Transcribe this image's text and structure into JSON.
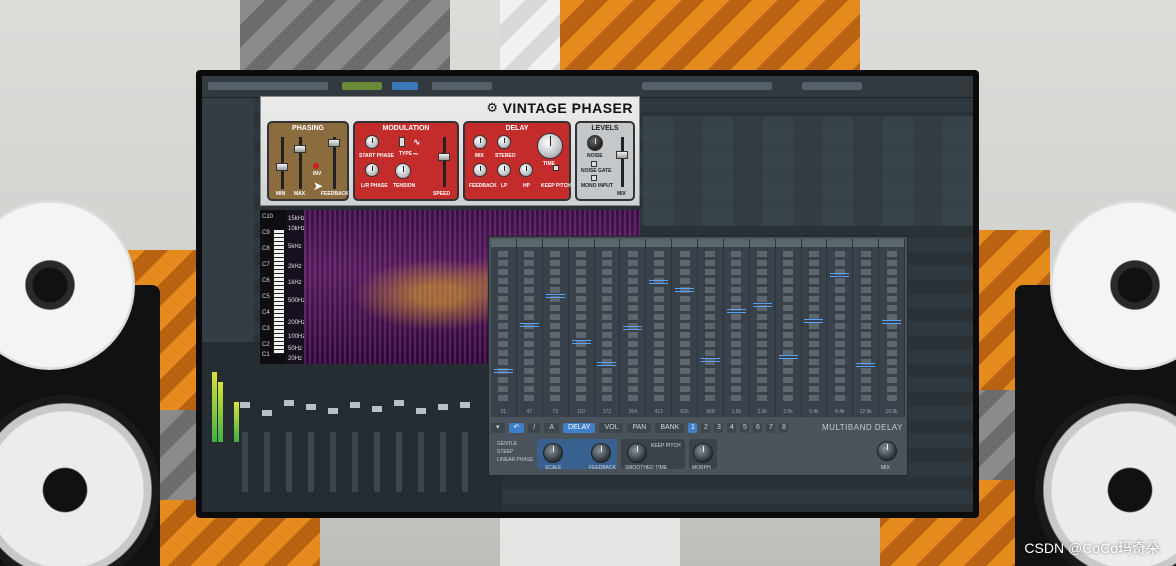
{
  "phaser": {
    "title": "VINTAGE PHASER",
    "icon": "gear-icon",
    "sections": {
      "phasing": {
        "title": "PHASING",
        "labels": [
          "MIN",
          "MAX",
          "INV",
          "FEEDBACK"
        ]
      },
      "modulation": {
        "title": "MODULATION",
        "labels": [
          "START PHASE",
          "TYPE",
          "L/R PHASE",
          "TENSION",
          "SPEED"
        ]
      },
      "delay": {
        "title": "DELAY",
        "labels": [
          "MIX",
          "STEREO",
          "TIME",
          "FEEDBACK",
          "LP",
          "HP",
          "KEEP PITCH"
        ]
      },
      "levels": {
        "title": "LEVELS",
        "labels": [
          "NOISE",
          "NOISE GATE",
          "MONO INPUT",
          "MIX"
        ]
      }
    }
  },
  "spectrogram": {
    "notes": [
      "C10",
      "C9",
      "C8",
      "C7",
      "C6",
      "C5",
      "C4",
      "C3",
      "C2",
      "C1"
    ],
    "freqs": [
      "15k",
      "10k",
      "5k",
      "2k",
      "1k",
      "500",
      "200",
      "100",
      "50",
      "20"
    ],
    "unit": "Hz"
  },
  "multiband_delay": {
    "title": "MULTIBAND DELAY",
    "toolbar": {
      "undo_icon": "undo-icon",
      "pencil": "/",
      "line": "A",
      "tabs": [
        "DELAY",
        "VOL",
        "PAN"
      ],
      "active_tab": "DELAY",
      "bank_label": "BANK",
      "banks": [
        "1",
        "2",
        "3",
        "4",
        "5",
        "6",
        "7",
        "8"
      ],
      "active_bank": "1"
    },
    "options": [
      "GENTLE",
      "STEEP",
      "LINEAR PHASE"
    ],
    "controls": {
      "scale": "SCALE",
      "feedback": "FEEDBACK",
      "smoothed_time": "SMOOTHED TIME",
      "keep_pitch": "KEEP PITCH",
      "morph": "MORPH",
      "mix": "MIX"
    },
    "bands": [
      {
        "freq": "31",
        "level": 0.82
      },
      {
        "freq": "47",
        "level": 0.5
      },
      {
        "freq": "73",
        "level": 0.3
      },
      {
        "freq": "110",
        "level": 0.62
      },
      {
        "freq": "172",
        "level": 0.77
      },
      {
        "freq": "264",
        "level": 0.52
      },
      {
        "freq": "413",
        "level": 0.2
      },
      {
        "freq": "626",
        "level": 0.26
      },
      {
        "freq": "968",
        "level": 0.74
      },
      {
        "freq": "1.5k",
        "level": 0.4
      },
      {
        "freq": "2.3k",
        "level": 0.36
      },
      {
        "freq": "3.5k",
        "level": 0.72
      },
      {
        "freq": "5.4k",
        "level": 0.47
      },
      {
        "freq": "8.4k",
        "level": 0.15
      },
      {
        "freq": "12.9k",
        "level": 0.78
      },
      {
        "freq": "19.9k",
        "level": 0.48
      }
    ]
  },
  "watermark": "CSDN @CoCo玛奇朵",
  "colors": {
    "phaser_red": "#c42b2b",
    "band_marker": "#5aa2ff",
    "active_blue": "#3f7fc9"
  }
}
